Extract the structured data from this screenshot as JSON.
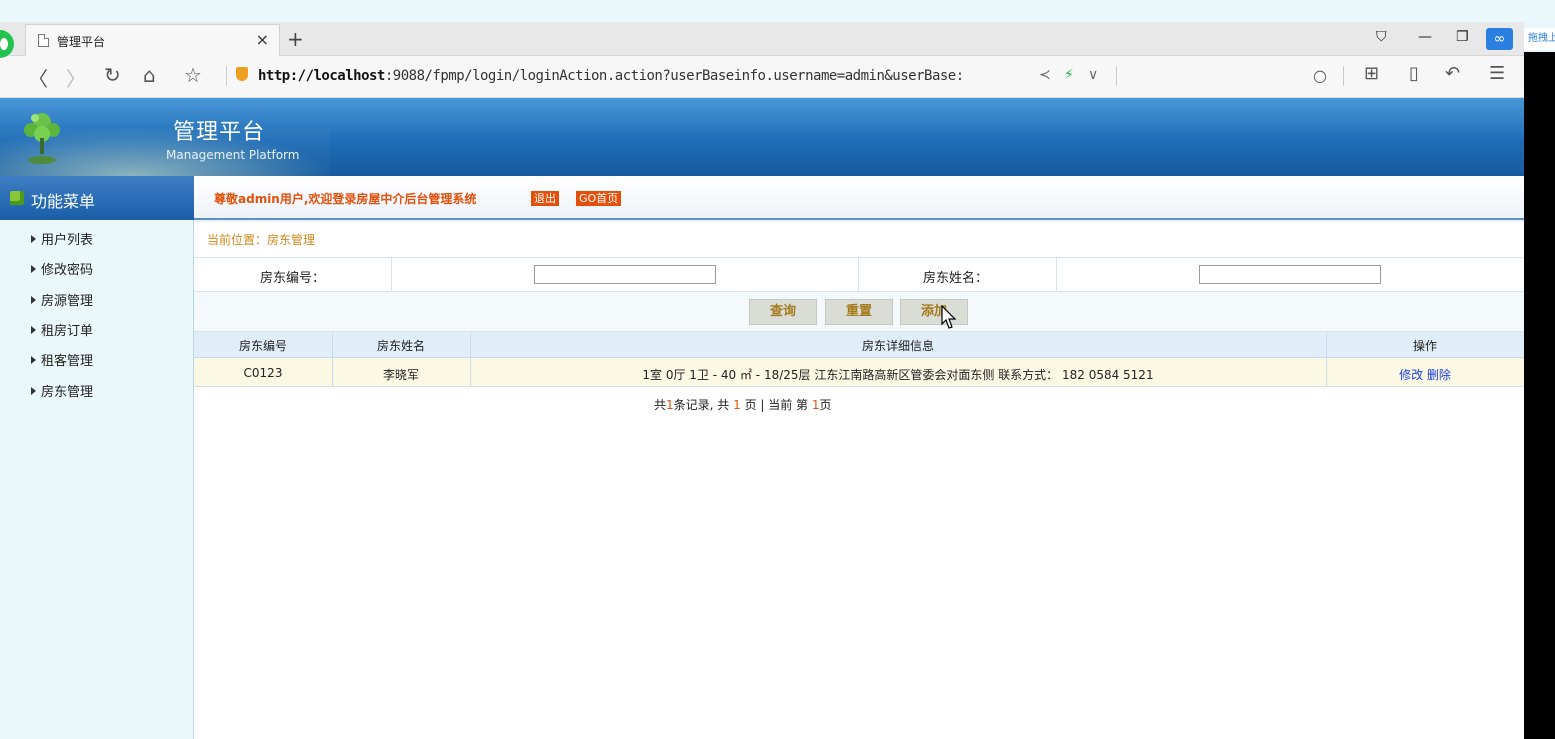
{
  "browser": {
    "tab_title": "管理平台",
    "tab_close": "×",
    "new_tab": "+",
    "address_host": "http://localhost",
    "address_rest": ":9088/fpmp/login/loginAction.action?userBaseinfo.username=admin&userBase:",
    "drag_label": "拖拽上传",
    "nav": {
      "back": "〈",
      "forward": "〉",
      "refresh": "↻",
      "home": "⌂",
      "star": "☆"
    },
    "win": {
      "skin": "⛉",
      "minimize": "—",
      "restore": "❐"
    },
    "toolbar": {
      "search": "○",
      "apps": "⊞",
      "reader": "▯",
      "undo": "↶",
      "menu": "☰"
    }
  },
  "header": {
    "title": "管理平台",
    "subtitle": "Management Platform"
  },
  "sidebar": {
    "heading": "功能菜单",
    "items": [
      {
        "label": "用户列表"
      },
      {
        "label": "修改密码"
      },
      {
        "label": "房源管理"
      },
      {
        "label": "租房订单"
      },
      {
        "label": "租客管理"
      },
      {
        "label": "房东管理"
      }
    ]
  },
  "welcome": {
    "text": "尊敬admin用户,欢迎登录房屋中介后台管理系统",
    "logout": "退出",
    "home": "GO首页"
  },
  "breadcrumb": "当前位置：房东管理",
  "search": {
    "id_label": "房东编号：",
    "id_value": "",
    "name_label": "房东姓名：",
    "name_value": ""
  },
  "buttons": {
    "query": "查询",
    "reset": "重置",
    "add": "添加"
  },
  "table": {
    "headers": [
      "房东编号",
      "房东姓名",
      "房东详细信息",
      "操作"
    ],
    "rows": [
      {
        "id": "C0123",
        "name": "李晓军",
        "detail": "1室 0厅 1卫 - 40 ㎡ - 18/25层 江东江南路高新区管委会对面东侧 联系方式： 182 0584 5121",
        "edit": "修改",
        "delete": "删除"
      }
    ]
  },
  "pager": {
    "p1": "共",
    "total_records": "1",
    "p2": "条记录, 共 ",
    "total_pages": "1",
    "p3": " 页 | 当前 第 ",
    "current_page": "1",
    "p4": "页"
  },
  "colors": {
    "header_blue": "#1f6db8",
    "accent_orange": "#e4500c",
    "link_blue": "#1a3de0"
  }
}
